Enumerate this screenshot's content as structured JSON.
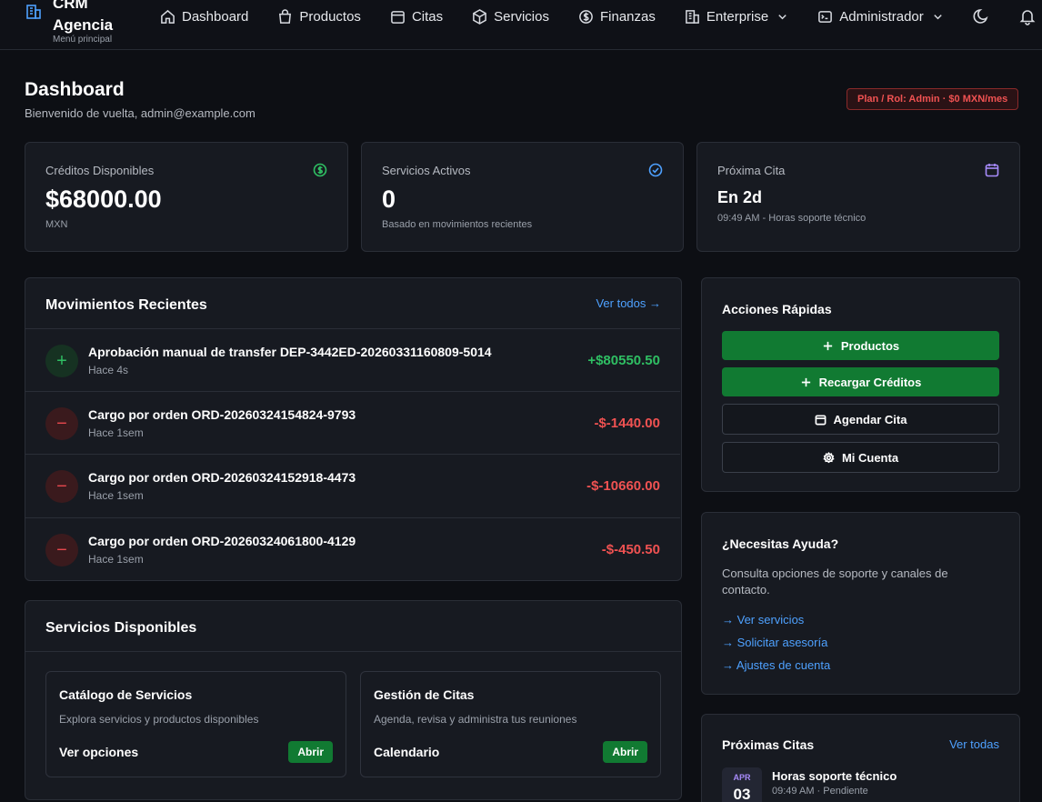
{
  "brand": {
    "title_line1": "CRM",
    "title_line2": "Agencia",
    "subtitle": "Menú principal",
    "icon": "building-icon"
  },
  "nav": {
    "items": [
      {
        "label": "Dashboard",
        "icon": "home-icon"
      },
      {
        "label": "Productos",
        "icon": "bag-icon"
      },
      {
        "label": "Citas",
        "icon": "calendar-icon"
      },
      {
        "label": "Servicios",
        "icon": "cube-icon"
      },
      {
        "label": "Finanzas",
        "icon": "dollar-icon"
      },
      {
        "label": "Enterprise",
        "icon": "building-icon"
      },
      {
        "label": "Administrador",
        "icon": "terminal-icon"
      }
    ]
  },
  "header": {
    "title": "Dashboard",
    "subtitle": "Bienvenido de vuelta, admin@example.com",
    "plan_badge": "Plan / Rol: Admin · $0 MXN/mes"
  },
  "stats": [
    {
      "label": "Créditos Disponibles",
      "value": "$68000.00",
      "note": "MXN",
      "icon": "dollar-circle-icon",
      "color": "#2fbf63"
    },
    {
      "label": "Servicios Activos",
      "value": "0",
      "note": "Basado en movimientos recientes",
      "icon": "check-circle-icon",
      "color": "#4ea1ff"
    },
    {
      "label": "Próxima Cita",
      "value": "En 2d",
      "note": "09:49 AM - Horas soporte técnico",
      "icon": "calendar-icon",
      "color": "#a78bfa"
    }
  ],
  "movimientos": {
    "title": "Movimientos Recientes",
    "view_all": "Ver todos →",
    "rows": [
      {
        "type": "plus",
        "title": "Aprobación manual de transfer DEP-3442ED-20260331160809-5014",
        "time": "Hace 4s",
        "amount": "+$80550.50"
      },
      {
        "type": "minus",
        "title": "Cargo por orden ORD-20260324154824-9793",
        "time": "Hace 1sem",
        "amount": "-$-1440.00"
      },
      {
        "type": "minus",
        "title": "Cargo por orden ORD-20260324152918-4473",
        "time": "Hace 1sem",
        "amount": "-$-10660.00"
      },
      {
        "type": "minus",
        "title": "Cargo por orden ORD-20260324061800-4129",
        "time": "Hace 1sem",
        "amount": "-$-450.50"
      }
    ]
  },
  "acciones": {
    "title": "Acciones Rápidas",
    "buttons": [
      {
        "label": "Productos",
        "icon": "plus-icon",
        "style": "primary"
      },
      {
        "label": "Recargar Créditos",
        "icon": "plus-icon",
        "style": "primary"
      },
      {
        "label": "Agendar Cita",
        "icon": "calendar-icon",
        "style": "outline"
      },
      {
        "label": "Mi Cuenta",
        "icon": "gear-icon",
        "style": "outline"
      }
    ]
  },
  "ayuda": {
    "title": "¿Necesitas Ayuda?",
    "text": "Consulta opciones de soporte y canales de contacto.",
    "links": [
      "→ Ver servicios",
      "→ Solicitar asesoría",
      "→ Ajustes de cuenta"
    ]
  },
  "servicios": {
    "title": "Servicios Disponibles",
    "cards": [
      {
        "title": "Catálogo de Servicios",
        "desc": "Explora servicios y productos disponibles",
        "footer": "Ver opciones",
        "button": "Abrir"
      },
      {
        "title": "Gestión de Citas",
        "desc": "Agenda, revisa y administra tus reuniones",
        "footer": "Calendario",
        "button": "Abrir"
      }
    ]
  },
  "proximas": {
    "title": "Próximas Citas",
    "view_all": "Ver todas",
    "item": {
      "month": "APR",
      "day": "03",
      "title": "Horas soporte técnico",
      "sub": "09:49 AM · Pendiente"
    }
  }
}
